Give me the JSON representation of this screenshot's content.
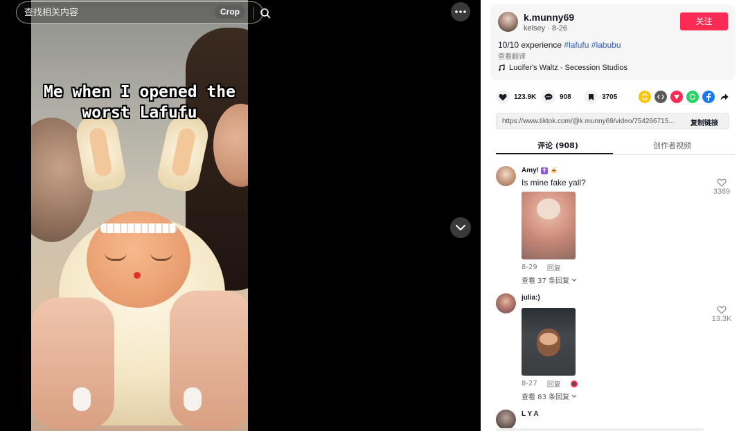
{
  "video": {
    "caption_line1": "Me when I opened the",
    "caption_line2": "worst Lafufu"
  },
  "search": {
    "placeholder": "查找相关内容",
    "crop_label": "Crop"
  },
  "author": {
    "username": "k.munny69",
    "nickname": "kelsey",
    "date": "8-26",
    "follow_label": "关注"
  },
  "post": {
    "desc_text": "10/10 experience ",
    "tag1": "#lafufu",
    "tag2": "#labubu",
    "translate": "查看翻译",
    "music": "Lucifer's Waltz - Secession Studios"
  },
  "stats": {
    "likes": "123.9K",
    "comments": "908",
    "saves": "3705"
  },
  "share": {
    "link": "https://www.tiktok.com/@k.munny69/video/754266715...",
    "copy_label": "复制链接"
  },
  "tabs": {
    "comments_label": "评论 (908)",
    "creator_label": "创作者视频"
  },
  "comments": [
    {
      "name": "Amy!",
      "badge": "🍝",
      "text": "Is mine fake yall?",
      "date": "8-29",
      "reply": "回复",
      "view_replies": "查看 37 条回复",
      "likes": "3389"
    },
    {
      "name": "julia:)",
      "text": "",
      "date": "8-27",
      "reply": "回复",
      "view_replies": "查看 83 条回复",
      "likes": "13.3K"
    },
    {
      "name": "L Y A"
    }
  ],
  "colors": {
    "accent": "#fe2c55",
    "hashtag": "#2b5db9",
    "text": "#161823"
  }
}
